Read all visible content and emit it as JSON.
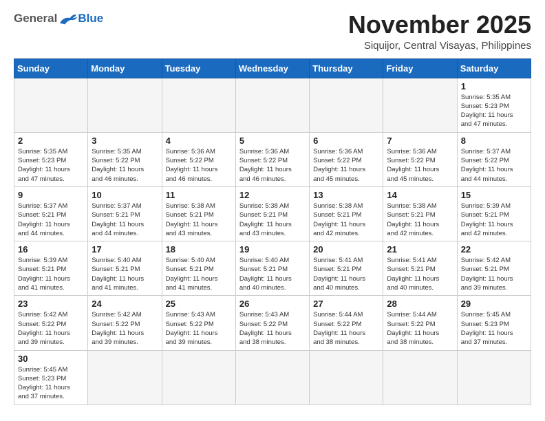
{
  "header": {
    "logo_general": "General",
    "logo_blue": "Blue",
    "month_title": "November 2025",
    "location": "Siquijor, Central Visayas, Philippines"
  },
  "weekdays": [
    "Sunday",
    "Monday",
    "Tuesday",
    "Wednesday",
    "Thursday",
    "Friday",
    "Saturday"
  ],
  "weeks": [
    [
      {
        "day": "",
        "info": ""
      },
      {
        "day": "",
        "info": ""
      },
      {
        "day": "",
        "info": ""
      },
      {
        "day": "",
        "info": ""
      },
      {
        "day": "",
        "info": ""
      },
      {
        "day": "",
        "info": ""
      },
      {
        "day": "1",
        "info": "Sunrise: 5:35 AM\nSunset: 5:23 PM\nDaylight: 11 hours\nand 47 minutes."
      }
    ],
    [
      {
        "day": "2",
        "info": "Sunrise: 5:35 AM\nSunset: 5:23 PM\nDaylight: 11 hours\nand 47 minutes."
      },
      {
        "day": "3",
        "info": "Sunrise: 5:35 AM\nSunset: 5:22 PM\nDaylight: 11 hours\nand 46 minutes."
      },
      {
        "day": "4",
        "info": "Sunrise: 5:36 AM\nSunset: 5:22 PM\nDaylight: 11 hours\nand 46 minutes."
      },
      {
        "day": "5",
        "info": "Sunrise: 5:36 AM\nSunset: 5:22 PM\nDaylight: 11 hours\nand 46 minutes."
      },
      {
        "day": "6",
        "info": "Sunrise: 5:36 AM\nSunset: 5:22 PM\nDaylight: 11 hours\nand 45 minutes."
      },
      {
        "day": "7",
        "info": "Sunrise: 5:36 AM\nSunset: 5:22 PM\nDaylight: 11 hours\nand 45 minutes."
      },
      {
        "day": "8",
        "info": "Sunrise: 5:37 AM\nSunset: 5:22 PM\nDaylight: 11 hours\nand 44 minutes."
      }
    ],
    [
      {
        "day": "9",
        "info": "Sunrise: 5:37 AM\nSunset: 5:21 PM\nDaylight: 11 hours\nand 44 minutes."
      },
      {
        "day": "10",
        "info": "Sunrise: 5:37 AM\nSunset: 5:21 PM\nDaylight: 11 hours\nand 44 minutes."
      },
      {
        "day": "11",
        "info": "Sunrise: 5:38 AM\nSunset: 5:21 PM\nDaylight: 11 hours\nand 43 minutes."
      },
      {
        "day": "12",
        "info": "Sunrise: 5:38 AM\nSunset: 5:21 PM\nDaylight: 11 hours\nand 43 minutes."
      },
      {
        "day": "13",
        "info": "Sunrise: 5:38 AM\nSunset: 5:21 PM\nDaylight: 11 hours\nand 42 minutes."
      },
      {
        "day": "14",
        "info": "Sunrise: 5:38 AM\nSunset: 5:21 PM\nDaylight: 11 hours\nand 42 minutes."
      },
      {
        "day": "15",
        "info": "Sunrise: 5:39 AM\nSunset: 5:21 PM\nDaylight: 11 hours\nand 42 minutes."
      }
    ],
    [
      {
        "day": "16",
        "info": "Sunrise: 5:39 AM\nSunset: 5:21 PM\nDaylight: 11 hours\nand 41 minutes."
      },
      {
        "day": "17",
        "info": "Sunrise: 5:40 AM\nSunset: 5:21 PM\nDaylight: 11 hours\nand 41 minutes."
      },
      {
        "day": "18",
        "info": "Sunrise: 5:40 AM\nSunset: 5:21 PM\nDaylight: 11 hours\nand 41 minutes."
      },
      {
        "day": "19",
        "info": "Sunrise: 5:40 AM\nSunset: 5:21 PM\nDaylight: 11 hours\nand 40 minutes."
      },
      {
        "day": "20",
        "info": "Sunrise: 5:41 AM\nSunset: 5:21 PM\nDaylight: 11 hours\nand 40 minutes."
      },
      {
        "day": "21",
        "info": "Sunrise: 5:41 AM\nSunset: 5:21 PM\nDaylight: 11 hours\nand 40 minutes."
      },
      {
        "day": "22",
        "info": "Sunrise: 5:42 AM\nSunset: 5:21 PM\nDaylight: 11 hours\nand 39 minutes."
      }
    ],
    [
      {
        "day": "23",
        "info": "Sunrise: 5:42 AM\nSunset: 5:22 PM\nDaylight: 11 hours\nand 39 minutes."
      },
      {
        "day": "24",
        "info": "Sunrise: 5:42 AM\nSunset: 5:22 PM\nDaylight: 11 hours\nand 39 minutes."
      },
      {
        "day": "25",
        "info": "Sunrise: 5:43 AM\nSunset: 5:22 PM\nDaylight: 11 hours\nand 39 minutes."
      },
      {
        "day": "26",
        "info": "Sunrise: 5:43 AM\nSunset: 5:22 PM\nDaylight: 11 hours\nand 38 minutes."
      },
      {
        "day": "27",
        "info": "Sunrise: 5:44 AM\nSunset: 5:22 PM\nDaylight: 11 hours\nand 38 minutes."
      },
      {
        "day": "28",
        "info": "Sunrise: 5:44 AM\nSunset: 5:22 PM\nDaylight: 11 hours\nand 38 minutes."
      },
      {
        "day": "29",
        "info": "Sunrise: 5:45 AM\nSunset: 5:23 PM\nDaylight: 11 hours\nand 37 minutes."
      }
    ],
    [
      {
        "day": "30",
        "info": "Sunrise: 5:45 AM\nSunset: 5:23 PM\nDaylight: 11 hours\nand 37 minutes."
      },
      {
        "day": "",
        "info": ""
      },
      {
        "day": "",
        "info": ""
      },
      {
        "day": "",
        "info": ""
      },
      {
        "day": "",
        "info": ""
      },
      {
        "day": "",
        "info": ""
      },
      {
        "day": "",
        "info": ""
      }
    ]
  ]
}
